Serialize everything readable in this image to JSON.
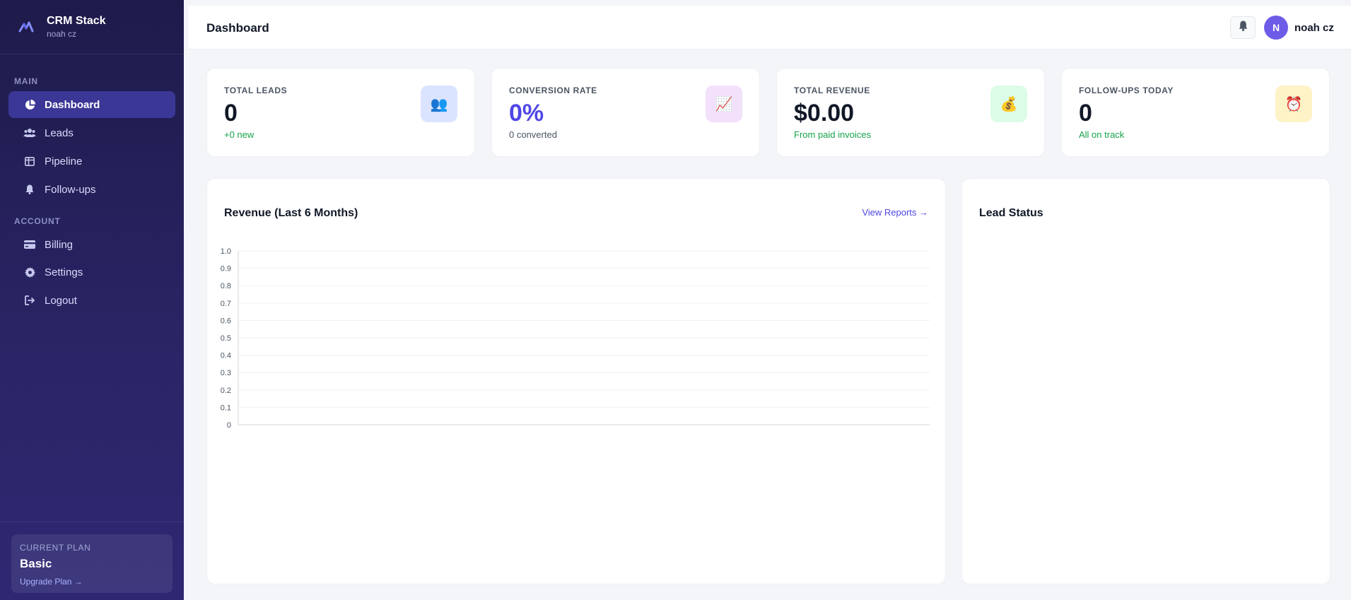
{
  "brand": {
    "name": "CRM Stack",
    "user": "noah cz"
  },
  "sidebar": {
    "main_label": "MAIN",
    "account_label": "ACCOUNT",
    "main_items": [
      {
        "label": "Dashboard",
        "icon": "pie-chart-icon",
        "active": true
      },
      {
        "label": "Leads",
        "icon": "users-icon",
        "active": false
      },
      {
        "label": "Pipeline",
        "icon": "columns-icon",
        "active": false
      },
      {
        "label": "Follow-ups",
        "icon": "bell-icon",
        "active": false
      }
    ],
    "account_items": [
      {
        "label": "Billing",
        "icon": "credit-card-icon"
      },
      {
        "label": "Settings",
        "icon": "gear-icon"
      },
      {
        "label": "Logout",
        "icon": "logout-icon"
      }
    ],
    "plan": {
      "label": "CURRENT PLAN",
      "name": "Basic",
      "upgrade": "Upgrade Plan →"
    }
  },
  "header": {
    "title": "Dashboard",
    "avatar_initial": "N",
    "user_name": "noah cz"
  },
  "stats": [
    {
      "title": "TOTAL LEADS",
      "value": "0",
      "note": "+0 new",
      "icon": "👥",
      "icon_name": "people-icon",
      "badge_color": "#dbe4ff"
    },
    {
      "title": "CONVERSION RATE",
      "value": "0%",
      "note": "0 converted",
      "icon": "📈",
      "icon_name": "chart-up-icon",
      "badge_color": "#f3e1fb"
    },
    {
      "title": "TOTAL REVENUE",
      "value": "$0.00",
      "note": "From paid invoices",
      "icon": "💰",
      "icon_name": "money-bag-icon",
      "badge_color": "#dcfce7"
    },
    {
      "title": "FOLLOW-UPS TODAY",
      "value": "0",
      "note": "All on track",
      "icon": "⏰",
      "icon_name": "alarm-clock-icon",
      "badge_color": "#fef3c7"
    }
  ],
  "revenue_card": {
    "title": "Revenue (Last 6 Months)",
    "link": "View Reports →"
  },
  "status_card": {
    "title": "Lead Status"
  },
  "colors": {
    "accent": "#4f46e5",
    "success": "#16a34a",
    "sidebar": "#1e1b4b"
  },
  "chart_data": {
    "type": "line",
    "title": "",
    "xlabel": "",
    "ylabel": "",
    "categories": [],
    "series": [],
    "yticks": [
      "1.0",
      "0.9",
      "0.8",
      "0.7",
      "0.6",
      "0.5",
      "0.4",
      "0.3",
      "0.2",
      "0.1",
      "0"
    ],
    "ylim": [
      0,
      1
    ],
    "grid": true
  }
}
